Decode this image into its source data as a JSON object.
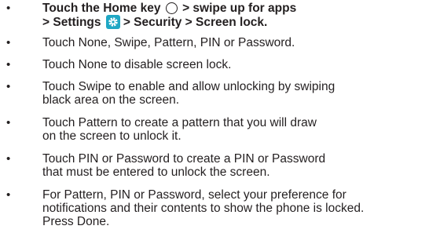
{
  "steps": [
    {
      "bullet": "•",
      "parts": {
        "a": "Touch the Home key",
        "b": "> swipe up for apps",
        "c": "> Settings",
        "d": "> Security > Screen lock."
      }
    },
    {
      "bullet": "•",
      "lines": [
        "Touch None, Swipe, Pattern, PIN or Password."
      ]
    },
    {
      "bullet": "•",
      "lines": [
        "Touch None to disable screen lock."
      ]
    },
    {
      "bullet": "•",
      "lines": [
        "Touch Swipe to enable and allow unlocking by swiping",
        "black area on the screen."
      ]
    },
    {
      "bullet": "•",
      "lines": [
        "Touch Pattern to create a pattern that you will draw",
        "on the screen to unlock it."
      ]
    },
    {
      "bullet": "•",
      "lines": [
        "Touch PIN or Password to create a PIN or Password",
        "that must be entered to unlock the screen."
      ]
    },
    {
      "bullet": "•",
      "lines": [
        "For Pattern, PIN or Password, select your preference for",
        "notifications and their contents to show the phone is locked.",
        "Press Done."
      ]
    }
  ],
  "icons": {
    "home": "home-key-icon",
    "settings": "settings-gear-icon",
    "settings_color": "#1fa7c4"
  }
}
